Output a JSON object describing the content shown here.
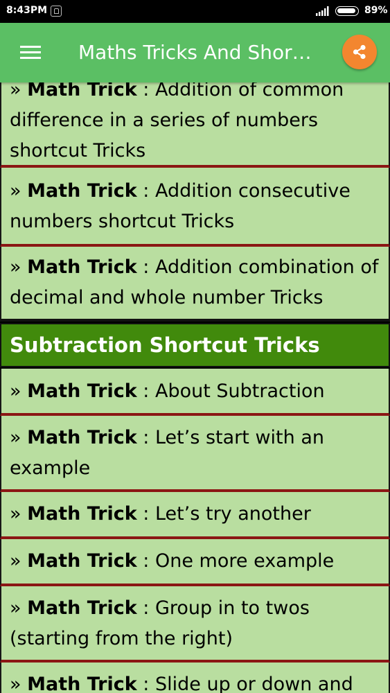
{
  "status_bar": {
    "time": "8:43PM",
    "battery": "89%"
  },
  "toolbar": {
    "title": "Maths Tricks And Shortcuts",
    "menu_icon": "hamburger-menu-icon",
    "share_icon": "share-icon"
  },
  "colors": {
    "toolbar": "#5bbf64",
    "share_button": "#f3862f",
    "item_background": "#b9dea0",
    "item_border": "#8b1614",
    "section_header": "#418a0c"
  },
  "list": {
    "item_prefix": "» ",
    "item_label": "Math Trick",
    "item_separator": " : ",
    "items_top": [
      {
        "text": "Addition of common difference in a series of numbers shortcut Tricks"
      },
      {
        "text": "Addition consecutive numbers shortcut Tricks"
      },
      {
        "text": "Addition combination of decimal and whole number Tricks"
      }
    ],
    "section_header": "Subtraction Shortcut Tricks",
    "items_bottom": [
      {
        "text": "About Subtraction"
      },
      {
        "text": "Let’s start with an example"
      },
      {
        "text": "Let’s try another"
      },
      {
        "text": "One more example"
      },
      {
        "text": "Group in to twos (starting from the right)"
      },
      {
        "text": "Slide up or down and"
      }
    ]
  }
}
